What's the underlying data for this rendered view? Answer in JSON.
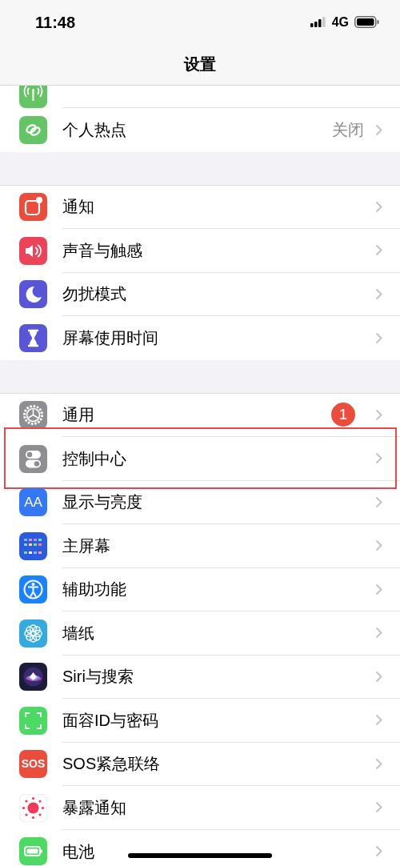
{
  "status_bar": {
    "time": "11:48",
    "network": "4G"
  },
  "nav": {
    "title": "设置"
  },
  "groups": [
    {
      "items": [
        {
          "label": "个人热点",
          "value": "关闭"
        }
      ]
    },
    {
      "items": [
        {
          "label": "通知"
        },
        {
          "label": "声音与触感"
        },
        {
          "label": "勿扰模式"
        },
        {
          "label": "屏幕使用时间"
        }
      ]
    },
    {
      "items": [
        {
          "label": "通用",
          "badge": "1"
        },
        {
          "label": "控制中心",
          "highlighted": true
        },
        {
          "label": "显示与亮度",
          "icon_text": "AA"
        },
        {
          "label": "主屏幕"
        },
        {
          "label": "辅助功能"
        },
        {
          "label": "墙纸"
        },
        {
          "label": "Siri与搜索"
        },
        {
          "label": "面容ID与密码"
        },
        {
          "label": "SOS紧急联络",
          "icon_text": "SOS"
        },
        {
          "label": "暴露通知"
        },
        {
          "label": "电池"
        }
      ]
    }
  ]
}
